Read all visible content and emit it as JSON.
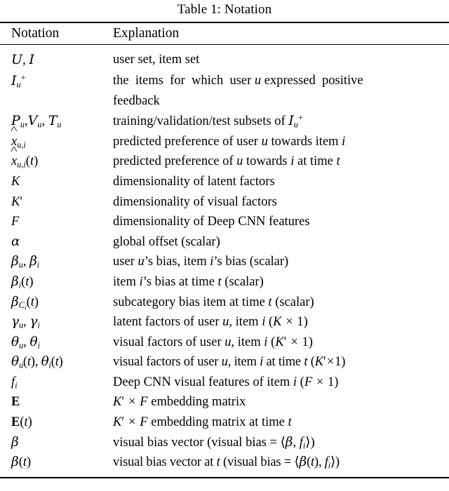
{
  "caption": "Table 1: Notation",
  "table": {
    "columns": [
      "Notation",
      "Explanation"
    ],
    "rows": [
      {
        "notation": "U, I",
        "explanation": "user set, item set"
      },
      {
        "notation": "I_u^+",
        "explanation": "the items for which user u expressed positive feedback"
      },
      {
        "notation": "P_u, V_u, T_u",
        "explanation": "training/validation/test subsets of I_u^+"
      },
      {
        "notation": "x̂_{u,i}",
        "explanation": "predicted preference of user u towards item i"
      },
      {
        "notation": "x̂_{u,i}(t)",
        "explanation": "predicted preference of u towards i at time t"
      },
      {
        "notation": "K",
        "explanation": "dimensionality of latent factors"
      },
      {
        "notation": "K'",
        "explanation": "dimensionality of visual factors"
      },
      {
        "notation": "F",
        "explanation": "dimensionality of Deep CNN features"
      },
      {
        "notation": "α",
        "explanation": "global offset (scalar)"
      },
      {
        "notation": "β_u, β_i",
        "explanation": "user u's bias, item i's bias (scalar)"
      },
      {
        "notation": "β_i(t)",
        "explanation": "item i's bias at time t (scalar)"
      },
      {
        "notation": "β_{C_i}(t)",
        "explanation": "subcategory bias item at time t (scalar)"
      },
      {
        "notation": "γ_u, γ_i",
        "explanation": "latent factors of user u, item i (K × 1)"
      },
      {
        "notation": "θ_u, θ_i",
        "explanation": "visual factors of user u, item i (K' × 1)"
      },
      {
        "notation": "θ_u(t), θ_i(t)",
        "explanation": "visual factors of user u, item i at time t (K'×1)"
      },
      {
        "notation": "f_i",
        "explanation": "Deep CNN visual features of item i (F × 1)"
      },
      {
        "notation": "E",
        "explanation": "K' × F embedding matrix"
      },
      {
        "notation": "E(t)",
        "explanation": "K' × F embedding matrix at time t"
      },
      {
        "notation": "β",
        "explanation": "visual bias vector (visual bias = ⟨β, f_i⟩)"
      },
      {
        "notation": "β(t)",
        "explanation": "visual bias vector at t (visual bias = ⟨β(t), f_i⟩)"
      }
    ]
  },
  "colors": {
    "text": "#000000",
    "background": "#ffffff",
    "rule": "#000000"
  }
}
